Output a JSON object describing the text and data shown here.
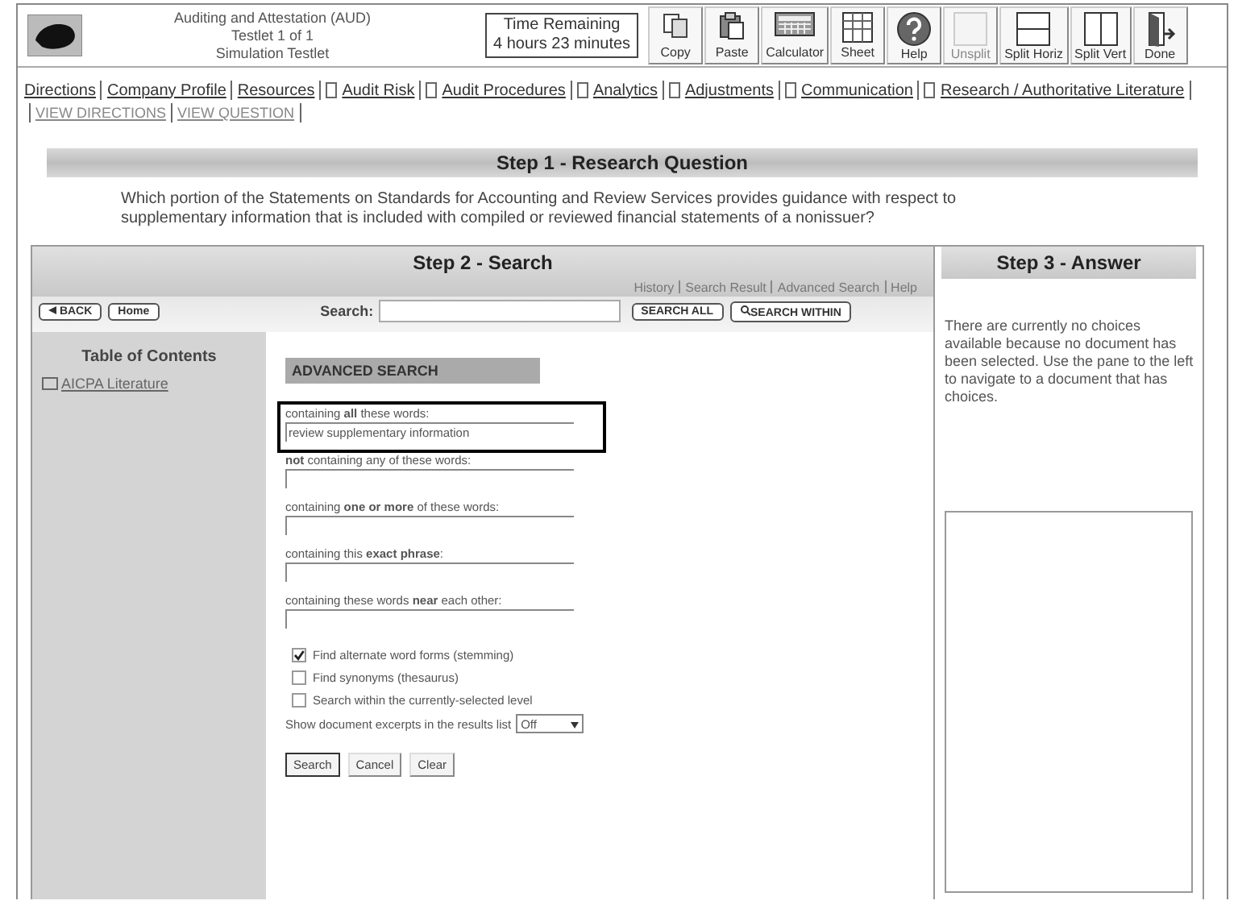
{
  "header": {
    "title_lines": [
      "Auditing and Attestation (AUD)",
      "Testlet 1 of 1",
      "Simulation Testlet"
    ],
    "timer": {
      "label": "Time Remaining",
      "value": "4 hours 23 minutes"
    },
    "tools": [
      {
        "kind": "copy",
        "label": "Copy",
        "disabled": false
      },
      {
        "kind": "paste",
        "label": "Paste",
        "disabled": false
      },
      {
        "kind": "calculator",
        "label": "Calculator",
        "disabled": false
      },
      {
        "kind": "sheet",
        "label": "Sheet",
        "disabled": false
      },
      {
        "kind": "help",
        "label": "Help",
        "disabled": false
      },
      {
        "kind": "unsplit",
        "label": "Unsplit",
        "disabled": true
      },
      {
        "kind": "split-horiz",
        "label": "Split Horiz",
        "disabled": false
      },
      {
        "kind": "split-vert",
        "label": "Split Vert",
        "disabled": false
      },
      {
        "kind": "done",
        "label": "Done",
        "disabled": false
      }
    ]
  },
  "nav_tabs": [
    {
      "kind": "plain",
      "label": "Directions"
    },
    {
      "kind": "plain",
      "label": "Company Profile"
    },
    {
      "kind": "plain",
      "label": "Resources"
    },
    {
      "kind": "task",
      "label": "Audit Risk"
    },
    {
      "kind": "task",
      "label": "Audit Procedures"
    },
    {
      "kind": "task",
      "label": "Analytics"
    },
    {
      "kind": "task",
      "label": "Adjustments"
    },
    {
      "kind": "task",
      "label": "Communication"
    },
    {
      "kind": "task",
      "label": "Research / Authoritative Literature"
    }
  ],
  "sub_links": [
    "VIEW DIRECTIONS",
    "VIEW QUESTION"
  ],
  "step1": {
    "title": "Step 1 - Research Question",
    "question": "Which portion of the Statements on Standards for Accounting and Review Services provides guidance with respect to supplementary information that is included with compiled or reviewed financial statements of a nonissuer?"
  },
  "step2": {
    "title": "Step 2 - Search",
    "links": [
      "History",
      "Search Result",
      "Advanced Search",
      "Help"
    ],
    "back_button": "BACK",
    "home_button": "Home",
    "search_label": "Search:",
    "search_all_button": "SEARCH ALL",
    "search_within_button": "SEARCH WITHIN",
    "toc_title": "Table of Contents",
    "toc_items": [
      "AICPA Literature"
    ],
    "advanced": {
      "title": "ADVANCED SEARCH",
      "fields": [
        {
          "label": "containing **all** these words:",
          "value": "review supplementary information",
          "highlighted": true
        },
        {
          "label": "**not** containing any of these words:",
          "highlighted": false
        },
        {
          "label": "containing **one or more** of these words:",
          "highlighted": false
        },
        {
          "label": "containing this **exact phrase**:",
          "highlighted": false
        },
        {
          "label": "containing these words **near** each other:",
          "highlighted": false
        }
      ],
      "options": [
        {
          "label": "Find alternate word forms (stemming)",
          "checked": true
        },
        {
          "label": "Find synonyms (thesaurus)",
          "checked": false
        },
        {
          "label": "Search within the currently-selected level",
          "checked": false
        }
      ],
      "excerpts_label": "Show document excerpts in the results list",
      "excerpts_value": "Off",
      "buttons": [
        "Search",
        "Cancel",
        "Clear"
      ]
    }
  },
  "step3": {
    "title": "Step 3 - Answer",
    "message": "There are currently no choices available because no document has been selected. Use the pane to the left to navigate to a document that has choices."
  }
}
